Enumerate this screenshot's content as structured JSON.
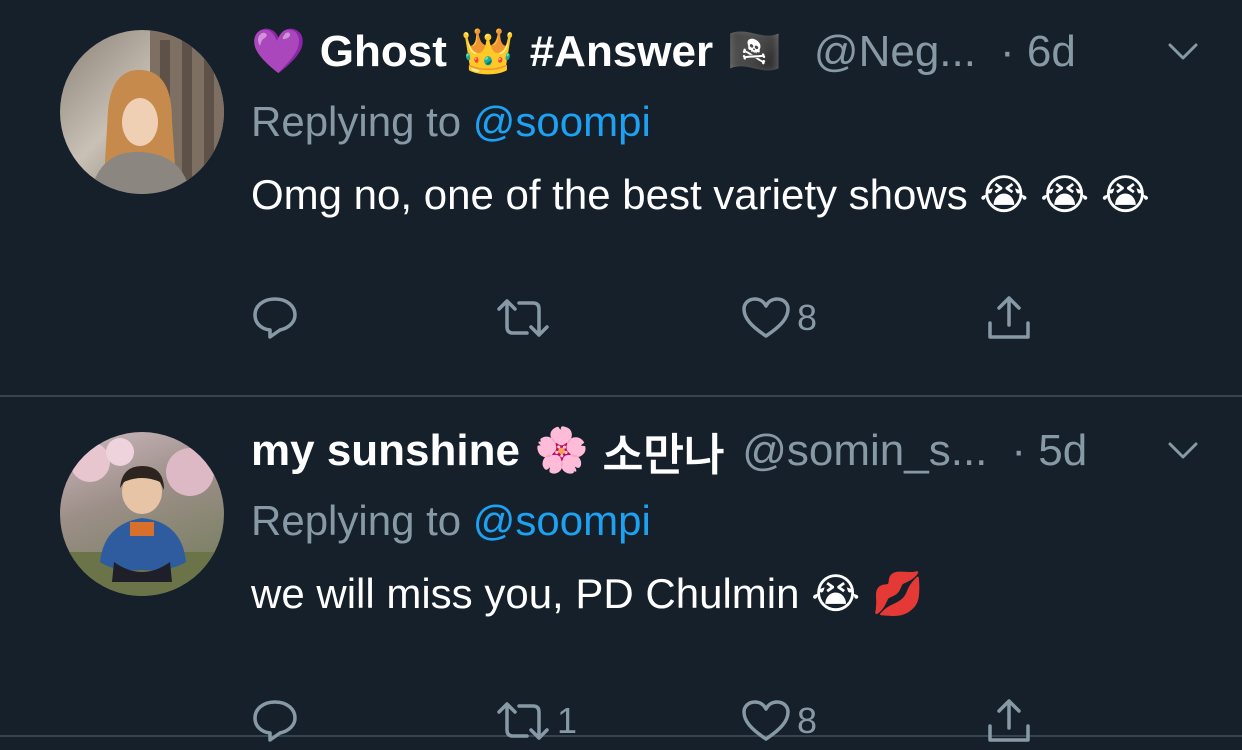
{
  "tweets": [
    {
      "name_parts": [
        "Ghost",
        "#Answer"
      ],
      "name_emojis": [
        "💜",
        "👑",
        "🏴‍☠️"
      ],
      "handle": "@Neg...",
      "time": "· 6d",
      "replying_prefix": "Replying to ",
      "replying_to": "@soompi",
      "text": "Omg no, one of the best variety shows 😭 😭 😭",
      "reply_count": "",
      "retweet_count": "",
      "like_count": "8"
    },
    {
      "name_parts": [
        "my sunshine",
        "소만나"
      ],
      "name_emojis": [
        "🌸"
      ],
      "handle": "@somin_s...",
      "time": "· 5d",
      "replying_prefix": "Replying to ",
      "replying_to": "@soompi",
      "text": "we will miss you, PD Chulmin 😭 💋",
      "reply_count": "",
      "retweet_count": "1",
      "like_count": "8"
    }
  ],
  "colors": {
    "background": "#15202b",
    "secondary_text": "#8899a6",
    "link": "#1da1f2",
    "divider": "#38444d"
  }
}
